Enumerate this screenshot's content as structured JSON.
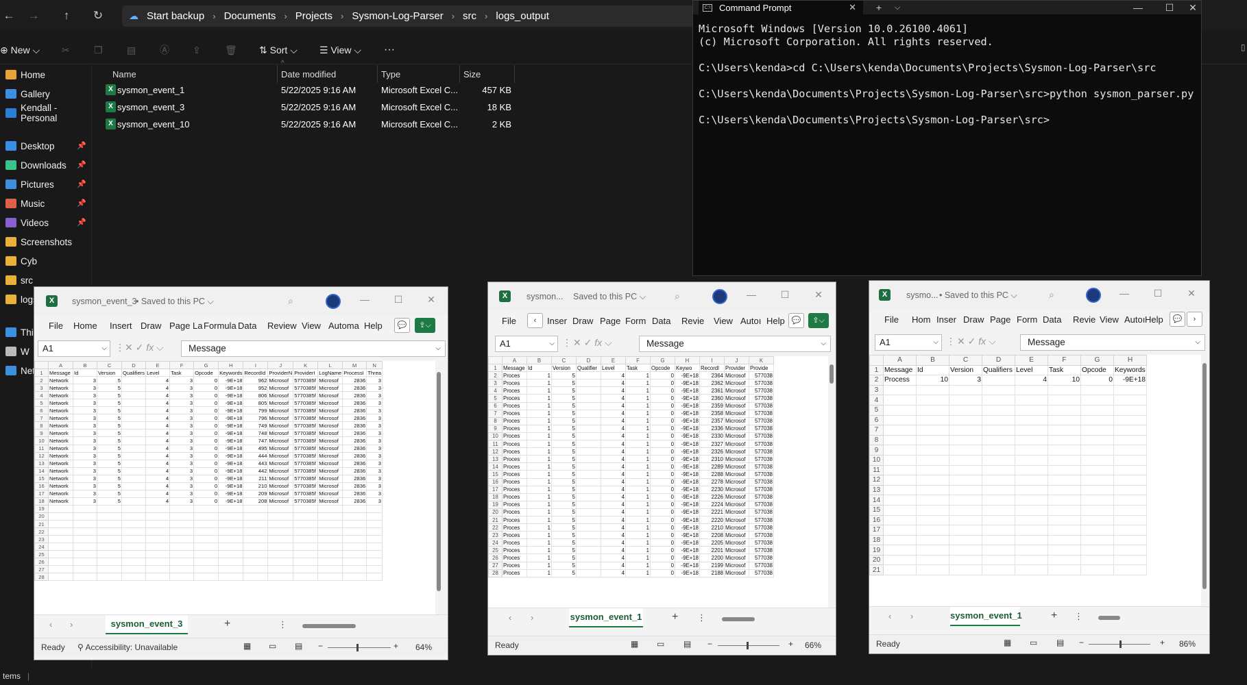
{
  "explorer": {
    "breadcrumbs": [
      "Start backup",
      "Documents",
      "Projects",
      "Sysmon-Log-Parser",
      "src",
      "logs_output"
    ],
    "toolbar": {
      "new": "New",
      "sort": "Sort",
      "view": "View",
      "more": "···"
    },
    "sidebar": [
      {
        "label": "Home",
        "color": "#e8a23a",
        "pinned": false
      },
      {
        "label": "Gallery",
        "color": "#3d8fe0",
        "pinned": false
      },
      {
        "label": "Kendall - Personal",
        "color": "#2d7fd6",
        "pinned": false
      },
      {
        "label": "Desktop",
        "color": "#3a8ee6",
        "pinned": true
      },
      {
        "label": "Downloads",
        "color": "#3cc28a",
        "pinned": true
      },
      {
        "label": "Pictures",
        "color": "#3f8fdd",
        "pinned": true
      },
      {
        "label": "Music",
        "color": "#e06048",
        "pinned": true
      },
      {
        "label": "Videos",
        "color": "#8b5fd4",
        "pinned": true
      },
      {
        "label": "Screenshots",
        "color": "#e8b23a",
        "pinned": false
      },
      {
        "label": "Cyb",
        "color": "#e8b23a",
        "pinned": false
      },
      {
        "label": "src",
        "color": "#e8b23a",
        "pinned": false
      },
      {
        "label": "logs",
        "color": "#e8b23a",
        "pinned": false
      },
      {
        "label": "This",
        "color": "#3d8fe0",
        "pinned": false
      },
      {
        "label": "W",
        "color": "#bbbbbb",
        "pinned": false
      },
      {
        "label": "Net",
        "color": "#3d8fe0",
        "pinned": false
      }
    ],
    "columns": {
      "name": "Name",
      "date": "Date modified",
      "type": "Type",
      "size": "Size"
    },
    "files": [
      {
        "name": "sysmon_event_1",
        "date": "5/22/2025 9:16 AM",
        "type": "Microsoft Excel C...",
        "size": "457 KB"
      },
      {
        "name": "sysmon_event_3",
        "date": "5/22/2025 9:16 AM",
        "type": "Microsoft Excel C...",
        "size": "18 KB"
      },
      {
        "name": "sysmon_event_10",
        "date": "5/22/2025 9:16 AM",
        "type": "Microsoft Excel C...",
        "size": "2 KB"
      }
    ],
    "status": "tems"
  },
  "cmd": {
    "title": "Command Prompt",
    "lines": [
      "Microsoft Windows [Version 10.0.26100.4061]",
      "(c) Microsoft Corporation. All rights reserved.",
      "",
      "C:\\Users\\kenda>cd C:\\Users\\kenda\\Documents\\Projects\\Sysmon-Log-Parser\\src",
      "",
      "C:\\Users\\kenda\\Documents\\Projects\\Sysmon-Log-Parser\\src>python sysmon_parser.py",
      "",
      "C:\\Users\\kenda\\Documents\\Projects\\Sysmon-Log-Parser\\src>"
    ]
  },
  "excel3": {
    "filename": "sysmon_event_3",
    "saved": "• Saved to this PC ⌵",
    "ribbon": [
      "File",
      "Home",
      "Insert",
      "Draw",
      "Page La",
      "Formula",
      "Data",
      "Review",
      "View",
      "Automa",
      "Help"
    ],
    "namebox": "A1",
    "formula": "Message",
    "cols": [
      "A",
      "B",
      "C",
      "D",
      "E",
      "F",
      "G",
      "H",
      "I",
      "J",
      "K",
      "L",
      "M",
      "N"
    ],
    "header": [
      "Message",
      "Id",
      "Version",
      "Qualifiers",
      "Level",
      "Task",
      "Opcode",
      "Keywords",
      "RecordId",
      "ProviderN",
      "ProviderI",
      "LogName",
      "ProcessI",
      "Threa"
    ],
    "rows": [
      [
        "Network",
        "3",
        "5",
        "",
        "4",
        "3",
        "0",
        "-9E+18",
        "962",
        "Microsof",
        "5770385f",
        "Microsof",
        "2836",
        "3"
      ],
      [
        "Network",
        "3",
        "5",
        "",
        "4",
        "3",
        "0",
        "-9E+18",
        "952",
        "Microsof",
        "5770385f",
        "Microsof",
        "2836",
        "3"
      ],
      [
        "Network",
        "3",
        "5",
        "",
        "4",
        "3",
        "0",
        "-9E+18",
        "806",
        "Microsof",
        "5770385f",
        "Microsof",
        "2836",
        "3"
      ],
      [
        "Network",
        "3",
        "5",
        "",
        "4",
        "3",
        "0",
        "-9E+18",
        "805",
        "Microsof",
        "5770385f",
        "Microsof",
        "2836",
        "3"
      ],
      [
        "Network",
        "3",
        "5",
        "",
        "4",
        "3",
        "0",
        "-9E+18",
        "799",
        "Microsof",
        "5770385f",
        "Microsof",
        "2836",
        "3"
      ],
      [
        "Network",
        "3",
        "5",
        "",
        "4",
        "3",
        "0",
        "-9E+18",
        "796",
        "Microsof",
        "5770385f",
        "Microsof",
        "2836",
        "3"
      ],
      [
        "Network",
        "3",
        "5",
        "",
        "4",
        "3",
        "0",
        "-9E+18",
        "749",
        "Microsof",
        "5770385f",
        "Microsof",
        "2836",
        "3"
      ],
      [
        "Network",
        "3",
        "5",
        "",
        "4",
        "3",
        "0",
        "-9E+18",
        "748",
        "Microsof",
        "5770385f",
        "Microsof",
        "2836",
        "3"
      ],
      [
        "Network",
        "3",
        "5",
        "",
        "4",
        "3",
        "0",
        "-9E+18",
        "747",
        "Microsof",
        "5770385f",
        "Microsof",
        "2836",
        "3"
      ],
      [
        "Network",
        "3",
        "5",
        "",
        "4",
        "3",
        "0",
        "-9E+18",
        "495",
        "Microsof",
        "5770385f",
        "Microsof",
        "2836",
        "3"
      ],
      [
        "Network",
        "3",
        "5",
        "",
        "4",
        "3",
        "0",
        "-9E+18",
        "444",
        "Microsof",
        "5770385f",
        "Microsof",
        "2836",
        "3"
      ],
      [
        "Network",
        "3",
        "5",
        "",
        "4",
        "3",
        "0",
        "-9E+18",
        "443",
        "Microsof",
        "5770385f",
        "Microsof",
        "2836",
        "3"
      ],
      [
        "Network",
        "3",
        "5",
        "",
        "4",
        "3",
        "0",
        "-9E+18",
        "442",
        "Microsof",
        "5770385f",
        "Microsof",
        "2836",
        "3"
      ],
      [
        "Network",
        "3",
        "5",
        "",
        "4",
        "3",
        "0",
        "-9E+18",
        "211",
        "Microsof",
        "5770385f",
        "Microsof",
        "2836",
        "3"
      ],
      [
        "Network",
        "3",
        "5",
        "",
        "4",
        "3",
        "0",
        "-9E+18",
        "210",
        "Microsof",
        "5770385f",
        "Microsof",
        "2836",
        "3"
      ],
      [
        "Network",
        "3",
        "5",
        "",
        "4",
        "3",
        "0",
        "-9E+18",
        "209",
        "Microsof",
        "5770385f",
        "Microsof",
        "2836",
        "3"
      ],
      [
        "Network",
        "3",
        "5",
        "",
        "4",
        "3",
        "0",
        "-9E+18",
        "208",
        "Microsof",
        "5770385f",
        "Microsof",
        "2836",
        "3"
      ]
    ],
    "total_rows": 28,
    "sheet": "sysmon_event_3",
    "status": "Ready",
    "accessibility": "Accessibility: Unavailable",
    "zoom": "64%"
  },
  "excel1": {
    "filename": "sysmon...",
    "saved": "Saved to this PC ⌵",
    "ribbon": [
      "File",
      "Inser",
      "Draw",
      "Page",
      "Form",
      "Data",
      "Revie",
      "View",
      "Autoı",
      "Help"
    ],
    "namebox": "A1",
    "formula": "Message",
    "cols": [
      "A",
      "B",
      "C",
      "D",
      "E",
      "F",
      "G",
      "H",
      "I",
      "J",
      "K"
    ],
    "header": [
      "Message",
      "Id",
      "Version",
      "Qualifier",
      "Level",
      "Task",
      "Opcode",
      "Keywo",
      "Recordl",
      "Provider",
      "Provide"
    ],
    "record_ids": [
      "2364",
      "2362",
      "2361",
      "2360",
      "2359",
      "2358",
      "2357",
      "2336",
      "2330",
      "2327",
      "2326",
      "2310",
      "2289",
      "2288",
      "2278",
      "2230",
      "2226",
      "2224",
      "2221",
      "2220",
      "2210",
      "2208",
      "2205",
      "2201",
      "2200",
      "2199",
      "2188"
    ],
    "row_template": [
      "Proces",
      "1",
      "5",
      "",
      "4",
      "1",
      "0",
      "-9E+18",
      "",
      "Microsof",
      "577038"
    ],
    "sheet": "sysmon_event_1",
    "status": "Ready",
    "zoom": "66%"
  },
  "excel10": {
    "filename": "sysmo...",
    "saved": "• Saved to this PC ⌵",
    "ribbon": [
      "File",
      "Hom",
      "Inser",
      "Draw",
      "Page",
      "Form",
      "Data",
      "Revie",
      "View",
      "Autoı",
      "Help"
    ],
    "namebox": "A1",
    "formula": "Message",
    "cols": [
      "A",
      "B",
      "C",
      "D",
      "E",
      "F",
      "G",
      "H"
    ],
    "header": [
      "Message",
      "Id",
      "Version",
      "Qualifiers",
      "Level",
      "Task",
      "Opcode",
      "Keywords"
    ],
    "rows": [
      [
        "Process",
        "10",
        "3",
        "",
        "4",
        "10",
        "0",
        "-9E+18"
      ]
    ],
    "total_rows": 21,
    "sheet": "sysmon_event_1",
    "status": "Ready",
    "zoom": "86%"
  }
}
